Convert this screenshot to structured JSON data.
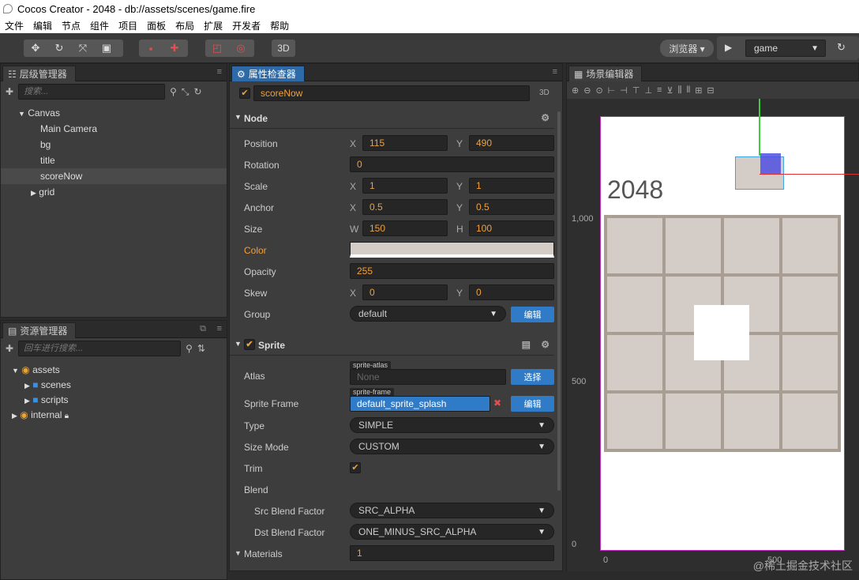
{
  "window": {
    "title": "Cocos Creator - 2048 - db://assets/scenes/game.fire"
  },
  "menu": [
    "文件",
    "编辑",
    "节点",
    "组件",
    "项目",
    "面板",
    "布局",
    "扩展",
    "开发者",
    "帮助"
  ],
  "toolbar": {
    "btn3d": "3D",
    "browser": "浏览器 ▾",
    "scene": "game"
  },
  "hierarchy": {
    "title": "层级管理器",
    "search_placeholder": "搜索...",
    "items": [
      {
        "label": "Canvas"
      },
      {
        "label": "Main Camera"
      },
      {
        "label": "bg"
      },
      {
        "label": "title"
      },
      {
        "label": "scoreNow"
      },
      {
        "label": "grid"
      }
    ]
  },
  "assets": {
    "title": "资源管理器",
    "search_placeholder": "回车进行搜索...",
    "items": [
      {
        "label": "assets"
      },
      {
        "label": "scenes"
      },
      {
        "label": "scripts"
      },
      {
        "label": "internal"
      }
    ]
  },
  "inspector": {
    "title": "属性检查器",
    "node_name": "scoreNow",
    "mode": "3D",
    "node_section": "Node",
    "position": {
      "label": "Position",
      "x": "115",
      "y": "490"
    },
    "rotation": {
      "label": "Rotation",
      "value": "0"
    },
    "scale": {
      "label": "Scale",
      "x": "1",
      "y": "1"
    },
    "anchor": {
      "label": "Anchor",
      "x": "0.5",
      "y": "0.5"
    },
    "size": {
      "label": "Size",
      "w": "150",
      "h": "100"
    },
    "color": {
      "label": "Color",
      "swatch": "#d4ccc6"
    },
    "opacity": {
      "label": "Opacity",
      "value": "255"
    },
    "skew": {
      "label": "Skew",
      "x": "0",
      "y": "0"
    },
    "group": {
      "label": "Group",
      "value": "default",
      "edit": "编辑"
    },
    "sprite_section": "Sprite",
    "atlas": {
      "label": "Atlas",
      "tag": "sprite-atlas",
      "value": "None",
      "btn": "选择"
    },
    "sprite_frame": {
      "label": "Sprite Frame",
      "tag": "sprite-frame",
      "value": "default_sprite_splash",
      "btn": "编辑"
    },
    "type": {
      "label": "Type",
      "value": "SIMPLE"
    },
    "size_mode": {
      "label": "Size Mode",
      "value": "CUSTOM"
    },
    "trim": {
      "label": "Trim"
    },
    "blend": {
      "label": "Blend"
    },
    "src_blend": {
      "label": "Src Blend Factor",
      "value": "SRC_ALPHA"
    },
    "dst_blend": {
      "label": "Dst Blend Factor",
      "value": "ONE_MINUS_SRC_ALPHA"
    },
    "materials": {
      "label": "Materials",
      "value": "1"
    },
    "axis_x": "X",
    "axis_y": "Y",
    "axis_w": "W",
    "axis_h": "H"
  },
  "scene": {
    "title": "场景编辑器",
    "game_title": "2048",
    "ruler_1000": "1,000",
    "ruler_500": "500",
    "ruler_0": "0",
    "ruler_bottom_0": "0",
    "ruler_bottom_500": "500"
  },
  "watermark": "@稀土掘金技术社区",
  "colors": {
    "accent": "#2e6aa8",
    "value_orange": "#f0a03c",
    "tile": "#d4ccc6",
    "board": "#a89e94"
  }
}
